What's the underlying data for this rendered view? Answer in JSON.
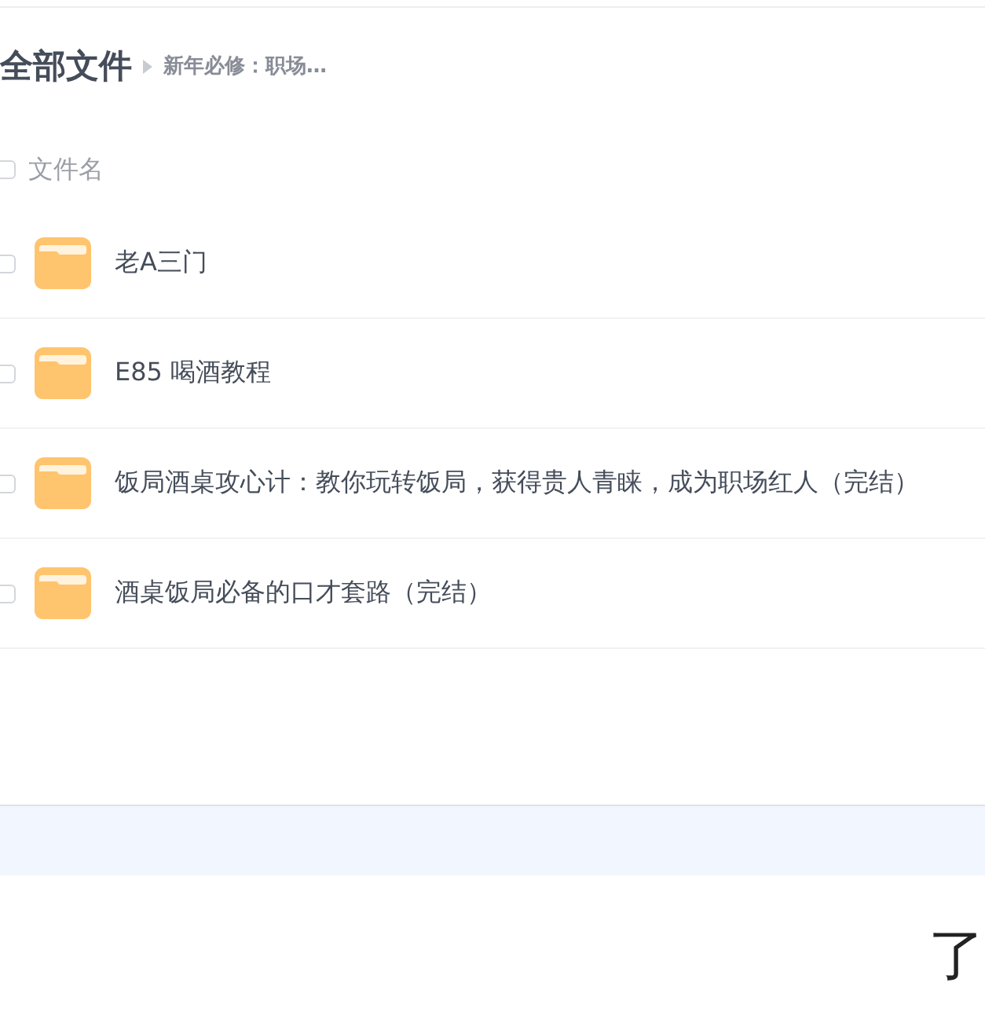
{
  "breadcrumb": {
    "root": "全部文件",
    "current": "新年必修：职场…"
  },
  "header": {
    "checked": false,
    "label": "文件名"
  },
  "files": [
    {
      "name": "老A三门",
      "kind": "folder",
      "checked": false
    },
    {
      "name": "E85 喝酒教程",
      "kind": "folder",
      "checked": false
    },
    {
      "name": "饭局酒桌攻心计：教你玩转饭局，获得贵人青睐，成为职场红人（完结）",
      "kind": "folder",
      "checked": false
    },
    {
      "name": "酒桌饭局必备的口才套路（完结）",
      "kind": "folder",
      "checked": false
    }
  ],
  "footer_heading": "了"
}
